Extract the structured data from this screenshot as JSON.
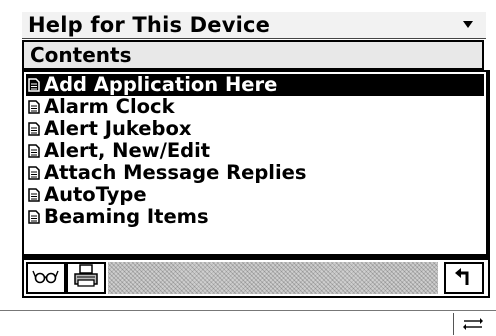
{
  "window": {
    "title": "Help for This Device",
    "menu_icon": "dropdown-arrow-icon"
  },
  "contents": {
    "heading": "Contents"
  },
  "topics": {
    "selected_index": 0,
    "item_icon": "document-icon",
    "items": [
      "Add Application Here",
      "Alarm Clock",
      "Alert Jukebox",
      "Alert, New/Edit",
      "Attach Message Replies",
      "AutoType",
      "Beaming Items"
    ]
  },
  "toolbar": {
    "buttons": [
      {
        "icon": "glasses-icon"
      },
      {
        "icon": "printer-icon"
      },
      {
        "icon": "back-arrow-icon"
      }
    ]
  },
  "statusbar": {
    "toggle_icon": "keyboard-toggle-icon"
  }
}
